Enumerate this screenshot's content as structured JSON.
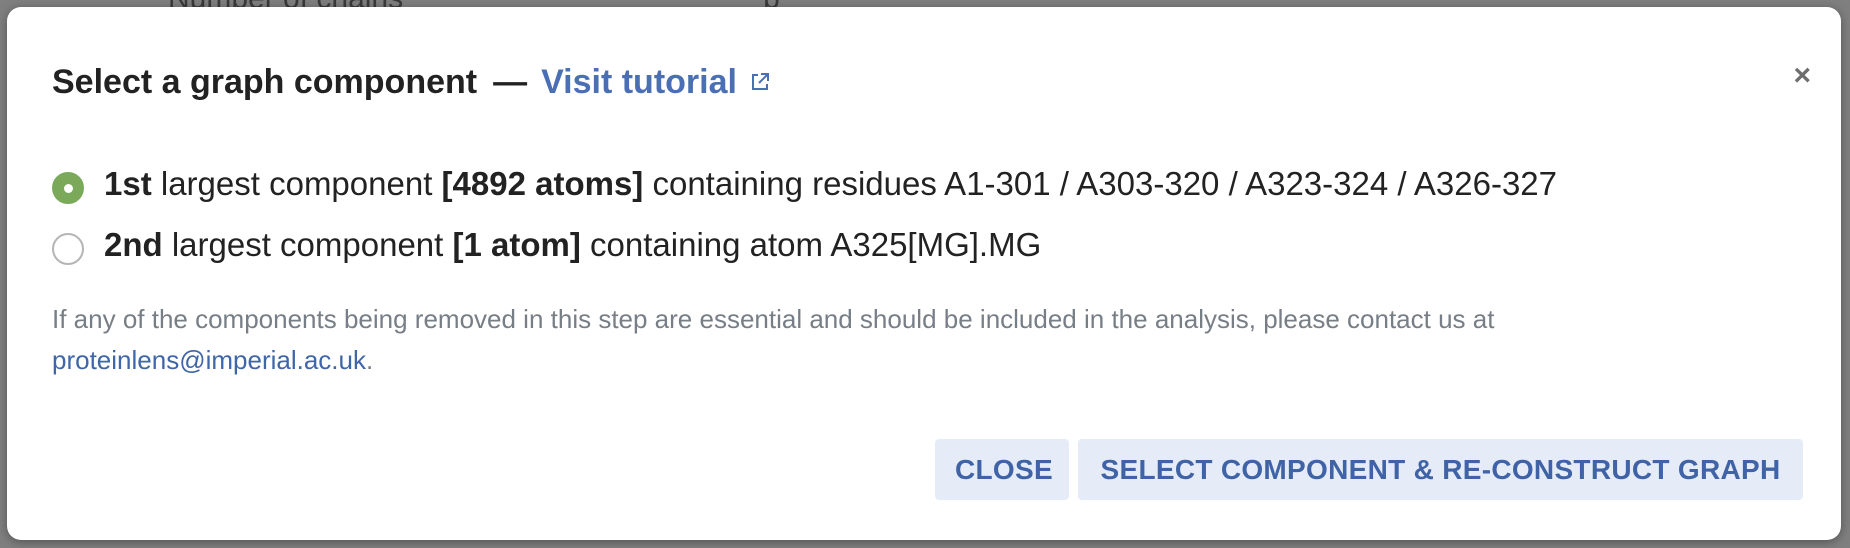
{
  "backdrop": {
    "partial_text": "Number of chains",
    "partial_text_right": "p"
  },
  "modal": {
    "title": "Select a graph component",
    "dash": "—",
    "tutorial_label": "Visit tutorial",
    "close_icon_glyph": "×",
    "options": [
      {
        "checked": true,
        "rank": "1st",
        "text_before_count": " largest component ",
        "count": "[4892 atoms]",
        "text_after_count": " containing residues A1-301 / A303-320 / A323-324 / A326-327"
      },
      {
        "checked": false,
        "rank": "2nd",
        "text_before_count": " largest component ",
        "count": "[1 atom]",
        "text_after_count": " containing atom A325[MG].MG"
      }
    ],
    "notice_text": "If any of the components being removed in this step are essential and should be included in the analysis, please contact us at ",
    "contact_email": "proteinlens@imperial.ac.uk",
    "notice_end": ".",
    "buttons": {
      "close_label": "CLOSE",
      "select_label": "SELECT COMPONENT & RE-CONSTRUCT GRAPH"
    }
  },
  "colors": {
    "accent_link": "#4a6fb5",
    "radio_checked": "#7aa95a",
    "button_bg": "#e6ecf7",
    "button_text": "#3f63a6",
    "overlay": "#7f7f7f"
  },
  "icons": {
    "external_link": "external-link-icon",
    "close": "close-icon"
  }
}
